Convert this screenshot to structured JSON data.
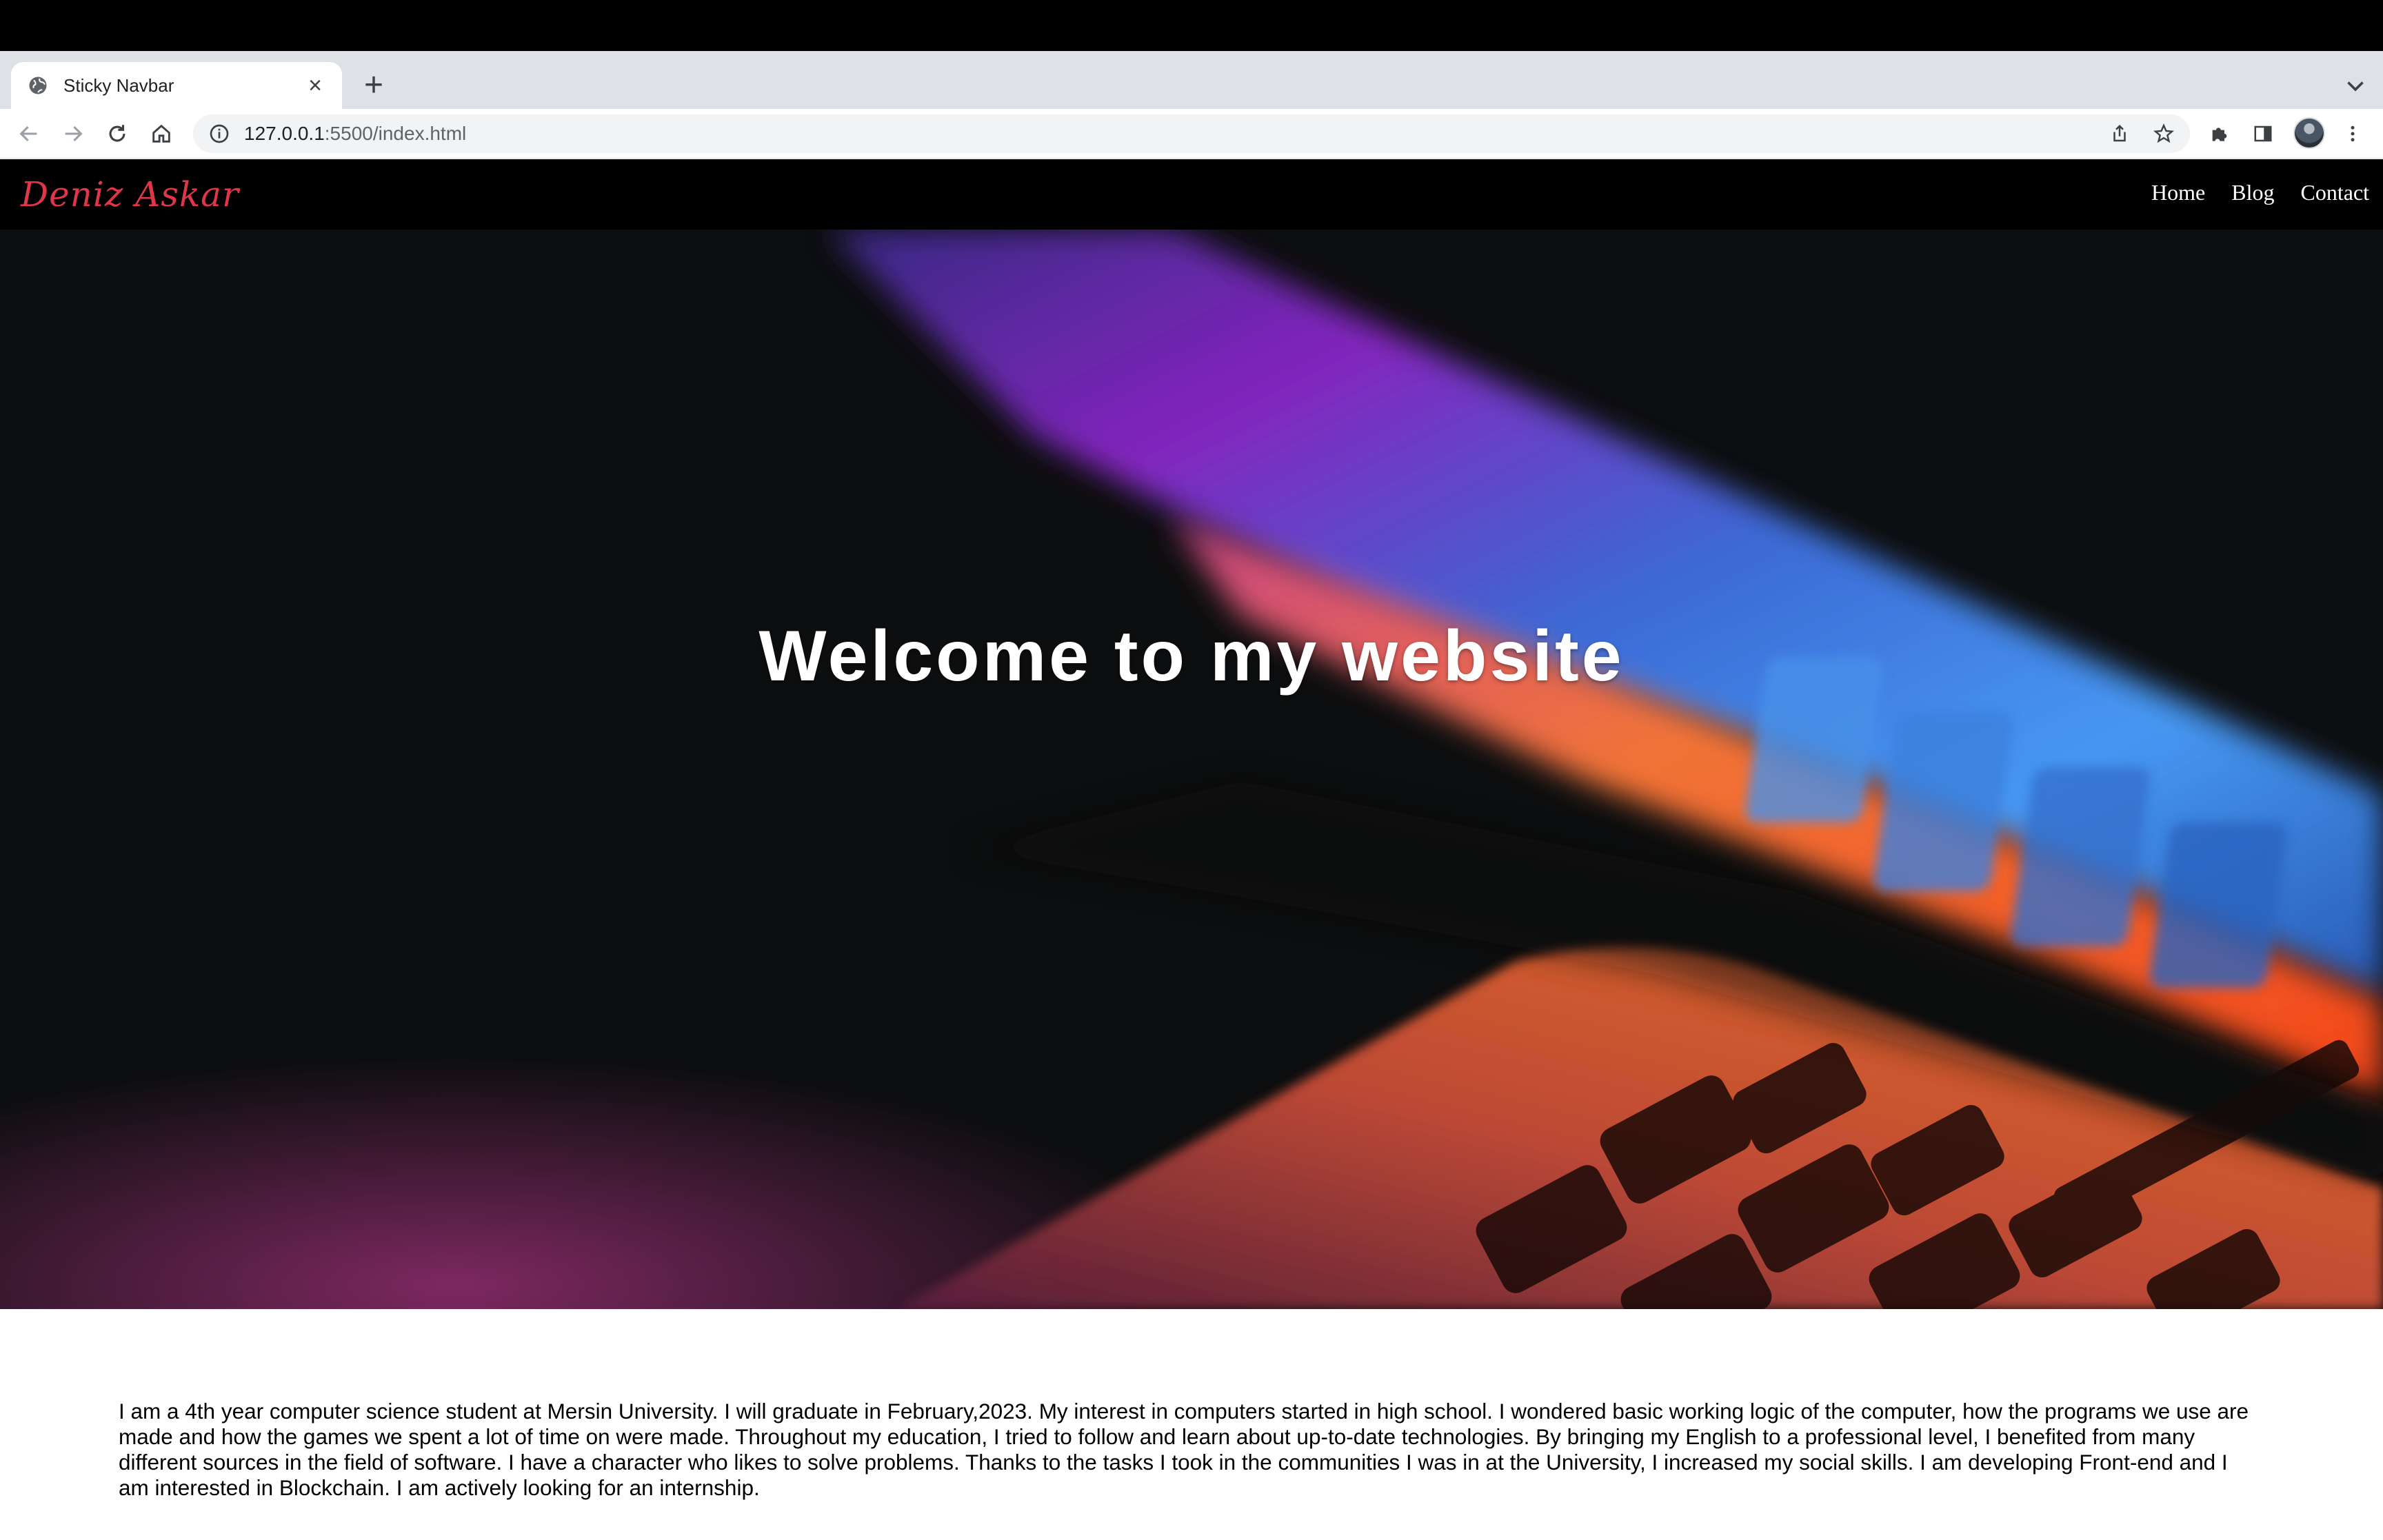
{
  "browser": {
    "tab_title": "Sticky Navbar",
    "url_host": "127.0.0.1",
    "url_path": ":5500/index.html"
  },
  "site": {
    "brand": "Deniz Askar",
    "brand_color": "#e0364a",
    "nav": [
      {
        "label": "Home"
      },
      {
        "label": "Blog"
      },
      {
        "label": "Contact"
      }
    ]
  },
  "hero": {
    "title": "Welcome to my website"
  },
  "about": {
    "text": "I am a 4th year computer science student at Mersin University. I will graduate in February,2023. My interest in computers started in high school. I wondered basic working logic of the computer, how the programs we use are made and how the games we spent a lot of time on were made. Throughout my education, I tried to follow and learn about up-to-date technologies. By bringing my English to a professional level, I benefited from many different sources in the field of software. I have a character who likes to solve problems. Thanks to the tasks I took in the communities I was in at the University, I increased my social skills. I am developing Front-end and I am interested in Blockchain. I am actively looking for an internship."
  },
  "icons": {
    "tab_favicon": "globe-icon",
    "tab_close": "close-icon",
    "new_tab": "plus-icon",
    "back": "arrow-left-icon",
    "forward": "arrow-right-icon",
    "reload": "reload-icon",
    "home": "home-icon",
    "site_info": "info-icon",
    "share": "share-icon",
    "bookmark": "star-icon",
    "extensions": "puzzle-icon",
    "side_panel": "side-panel-icon",
    "menu": "kebab-menu-icon"
  }
}
